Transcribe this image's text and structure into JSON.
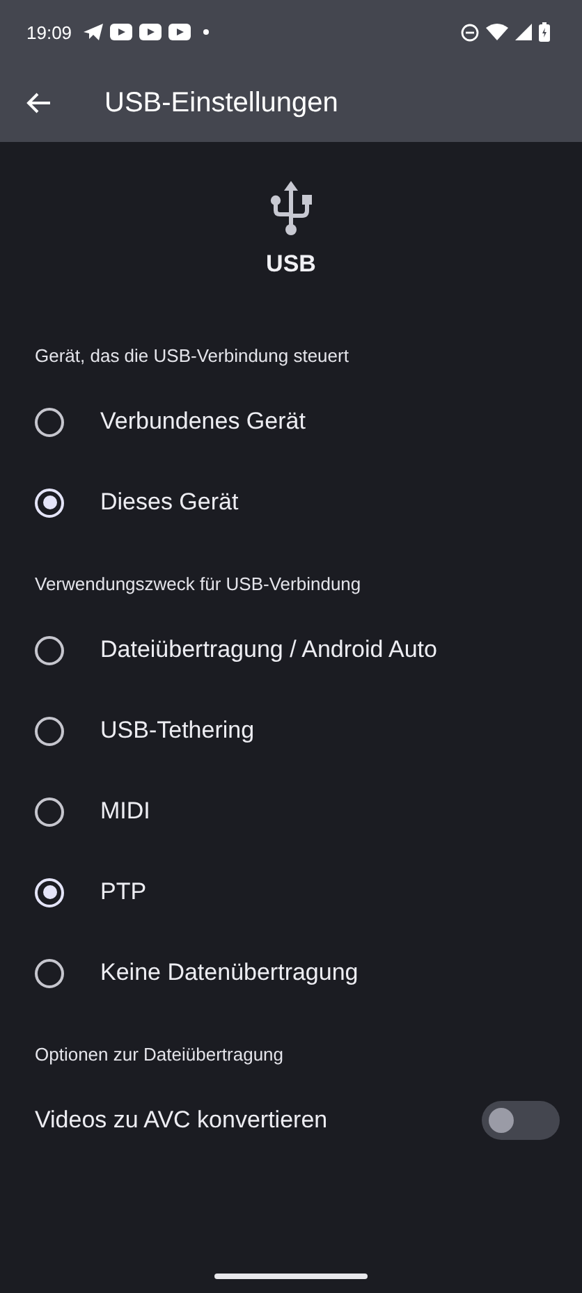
{
  "status_bar": {
    "time": "19:09"
  },
  "app_bar": {
    "title": "USB-Einstellungen"
  },
  "header": {
    "label": "USB"
  },
  "sections": [
    {
      "title": "Gerät, das die USB-Verbindung steuert",
      "items": [
        {
          "kind": "radio",
          "label": "Verbundenes Gerät",
          "selected": false
        },
        {
          "kind": "radio",
          "label": "Dieses Gerät",
          "selected": true
        }
      ]
    },
    {
      "title": "Verwendungszweck für USB-Verbindung",
      "items": [
        {
          "kind": "radio",
          "label": "Dateiübertragung / Android Auto",
          "selected": false
        },
        {
          "kind": "radio",
          "label": "USB-Tethering",
          "selected": false
        },
        {
          "kind": "radio",
          "label": "MIDI",
          "selected": false
        },
        {
          "kind": "radio",
          "label": "PTP",
          "selected": true
        },
        {
          "kind": "radio",
          "label": "Keine Datenübertragung",
          "selected": false
        }
      ]
    },
    {
      "title": "Optionen zur Dateiübertragung",
      "items": [
        {
          "kind": "switch",
          "label": "Videos zu AVC konvertieren",
          "on": false
        }
      ]
    }
  ]
}
